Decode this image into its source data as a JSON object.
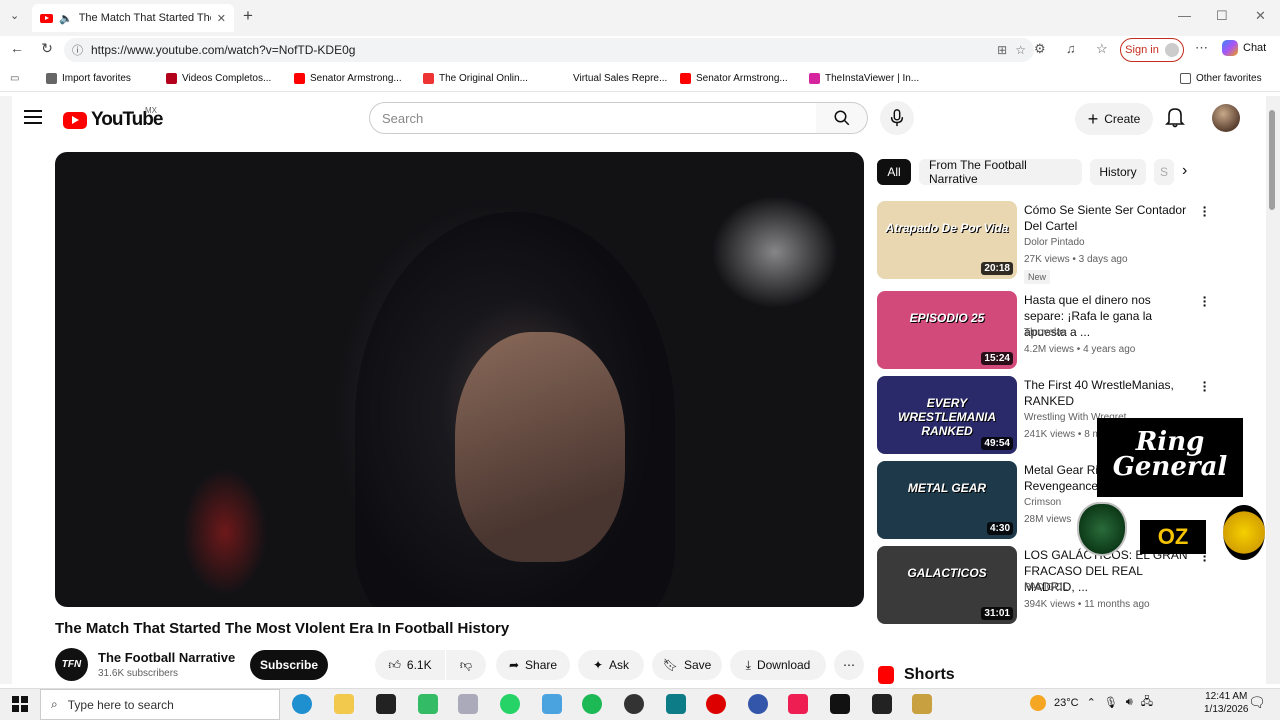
{
  "browser": {
    "tab_title": "The Match That Started The M",
    "url": "https://www.youtube.com/watch?v=NofTD-KDE0g",
    "signin_label": "Sign in",
    "chat_label": "Chat",
    "win_min": "—",
    "win_max": "☐",
    "win_close": "✕",
    "new_tab": "+",
    "favorites": [
      {
        "label": "Import favorites",
        "color": "#666"
      },
      {
        "label": "Videos Completos...",
        "color": "#b3001b"
      },
      {
        "label": "Senator Armstrong...",
        "color": "#ff0000"
      },
      {
        "label": "The Original Onlin...",
        "color": "#e33"
      },
      {
        "label": "Virtual Sales Repre...",
        "color": "#ffffff"
      },
      {
        "label": "Senator Armstrong...",
        "color": "#ff0000"
      },
      {
        "label": "TheInstaViewer | In...",
        "color": "#d6249f"
      }
    ],
    "other_favorites": "Other favorites"
  },
  "youtube": {
    "logo_text": "YouTube",
    "region": "MX",
    "search_placeholder": "Search",
    "create_label": "Create"
  },
  "video": {
    "title": "The Match That Started The Most VIolent Era In Football History",
    "channel_name": "The Football Narrative",
    "channel_initials": "TFN",
    "subscribers": "31.6K subscribers",
    "subscribe_label": "Subscribe",
    "likes": "6.1K",
    "share_label": "Share",
    "ask_label": "Ask",
    "save_label": "Save",
    "download_label": "Download"
  },
  "chips": [
    "All",
    "From The Football Narrative",
    "History",
    "S"
  ],
  "recommendations": [
    {
      "title": "Cómo Se Siente Ser Contador Del Cartel",
      "channel": "Dolor Pintado",
      "meta": "27K views • 3 days ago",
      "duration": "20:18",
      "badge": "New",
      "thumb_color": "#e8d7b0",
      "thumb_text": "Atrapado De Por Vida"
    },
    {
      "title": "Hasta que el dinero nos separe: ¡Rafa le gana la apuesta a ...",
      "channel": "Tlnovelas",
      "meta": "4.2M views • 4 years ago",
      "duration": "15:24",
      "badge": "",
      "thumb_color": "#d24a7a",
      "thumb_text": "EPISODIO 25"
    },
    {
      "title": "The First 40 WrestleManias, RANKED",
      "channel": "Wrestling With Wregret",
      "meta": "241K views • 8 m",
      "duration": "49:54",
      "badge": "",
      "thumb_color": "#2a2a6a",
      "thumb_text": "EVERY WRESTLEMANIA RANKED"
    },
    {
      "title": "Metal Gear Rising: Revengeance",
      "channel": "Crimson",
      "meta": "28M views",
      "duration": "4:30",
      "badge": "",
      "thumb_color": "#1e3a4a",
      "thumb_text": "METAL GEAR"
    },
    {
      "title": "LOS GALÁCTICOS: EL GRAN FRACASO DEL REAL MADRID, ...",
      "channel": "PADIGOL",
      "meta": "394K views • 11 months ago",
      "duration": "31:01",
      "badge": "",
      "thumb_color": "#3a3a3a",
      "thumb_text": "GALACTICOS"
    }
  ],
  "shorts_label": "Shorts",
  "overlays": {
    "ring_general": "Ring General",
    "oz": "OZ"
  },
  "taskbar": {
    "search_placeholder": "Type here to search",
    "temperature": "23°C",
    "time": "12:41 AM",
    "date": "1/13/2026"
  }
}
